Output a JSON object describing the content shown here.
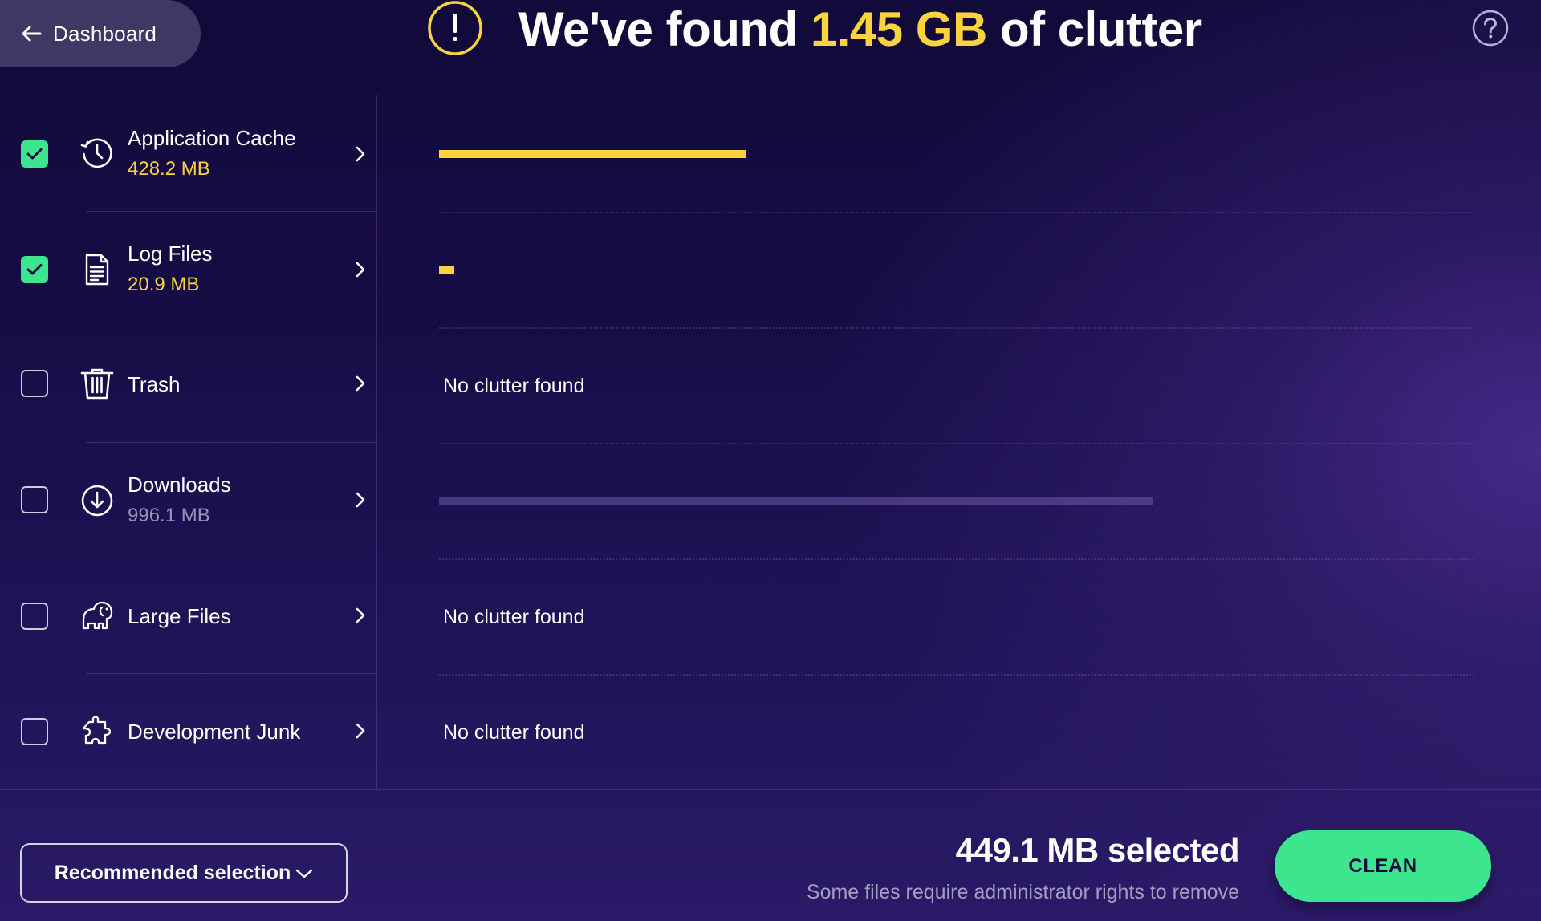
{
  "header": {
    "back_label": "Dashboard",
    "back_icon": "arrow-left-icon",
    "warning_icon": "exclamation-circle-icon",
    "title_prefix": "We've found ",
    "title_amount": "1.45 GB",
    "title_suffix": " of clutter",
    "help_icon": "question-circle-icon"
  },
  "colors": {
    "accent_yellow": "#fad43f",
    "accent_green": "#3ee58f",
    "pill_bg": "#403864",
    "bg_dark": "#120a3a",
    "bg_purple": "#3e2580"
  },
  "categories": [
    {
      "name": "Application Cache",
      "size": "428.2 MB",
      "checked": true,
      "enabled": true,
      "icon": "history-clock-icon",
      "size_mb": 428.2,
      "status": ""
    },
    {
      "name": "Log Files",
      "size": "20.9 MB",
      "checked": true,
      "enabled": true,
      "icon": "document-icon",
      "size_mb": 20.9,
      "status": ""
    },
    {
      "name": "Trash",
      "size": "",
      "checked": false,
      "enabled": false,
      "icon": "trash-icon",
      "size_mb": 0,
      "status": "No clutter found"
    },
    {
      "name": "Downloads",
      "size": "996.1 MB",
      "checked": false,
      "enabled": true,
      "icon": "download-circle-icon",
      "size_mb": 996.1,
      "status": ""
    },
    {
      "name": "Large Files",
      "size": "",
      "checked": false,
      "enabled": false,
      "icon": "elephant-icon",
      "size_mb": 0,
      "status": "No clutter found"
    },
    {
      "name": "Development Junk",
      "size": "",
      "checked": false,
      "enabled": false,
      "icon": "puzzle-icon",
      "size_mb": 0,
      "status": "No clutter found"
    }
  ],
  "footer": {
    "selection_dropdown": "Recommended selection",
    "selected_summary": "449.1 MB selected",
    "admin_note": "Some files require administrator rights to remove",
    "clean_label": "CLEAN"
  }
}
